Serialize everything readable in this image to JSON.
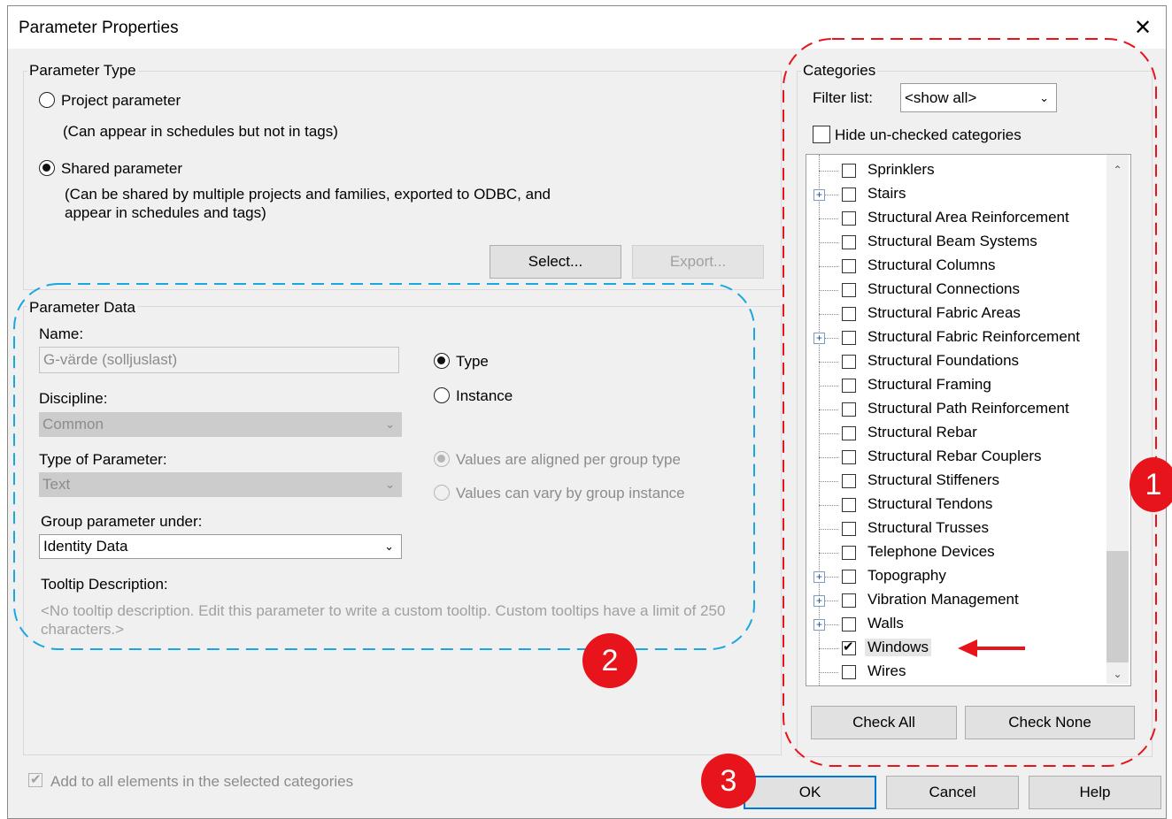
{
  "window": {
    "title": "Parameter Properties",
    "close_label": "✕"
  },
  "parameter_type": {
    "group_label": "Parameter Type",
    "project_label": "Project parameter",
    "project_desc": "(Can appear in schedules but not in tags)",
    "shared_label": "Shared parameter",
    "shared_desc_1": "(Can be shared by multiple projects and families, exported to ODBC, and",
    "shared_desc_2": "appear in schedules and tags)",
    "selected": "shared",
    "select_button": "Select...",
    "export_button": "Export..."
  },
  "parameter_data": {
    "group_label": "Parameter Data",
    "name_label": "Name:",
    "name_value": "G-värde (solljuslast)",
    "discipline_label": "Discipline:",
    "discipline_value": "Common",
    "type_label": "Type of Parameter:",
    "type_value": "Text",
    "group_under_label": "Group parameter under:",
    "group_under_value": "Identity Data",
    "tooltip_label": "Tooltip Description:",
    "tooltip_text_1": "<No tooltip description. Edit this parameter to write a custom tooltip. Custom tooltips have a limit of 250",
    "tooltip_text_2": "characters.>",
    "type_radio": "Type",
    "instance_radio": "Instance",
    "instance_kind": "type",
    "aligned_radio": "Values are aligned per group type",
    "vary_radio": "Values can vary by group instance"
  },
  "add_to_all": {
    "label": "Add to all elements in the selected categories",
    "checked": true,
    "disabled": true
  },
  "categories": {
    "group_label": "Categories",
    "filter_label": "Filter list:",
    "filter_value": "<show all>",
    "hide_unchecked_label": "Hide un-checked categories",
    "items": [
      {
        "label": "Sprinklers",
        "checked": false,
        "expandable": false
      },
      {
        "label": "Stairs",
        "checked": false,
        "expandable": true
      },
      {
        "label": "Structural Area Reinforcement",
        "checked": false,
        "expandable": false
      },
      {
        "label": "Structural Beam Systems",
        "checked": false,
        "expandable": false
      },
      {
        "label": "Structural Columns",
        "checked": false,
        "expandable": false
      },
      {
        "label": "Structural Connections",
        "checked": false,
        "expandable": false
      },
      {
        "label": "Structural Fabric Areas",
        "checked": false,
        "expandable": false
      },
      {
        "label": "Structural Fabric Reinforcement",
        "checked": false,
        "expandable": true
      },
      {
        "label": "Structural Foundations",
        "checked": false,
        "expandable": false
      },
      {
        "label": "Structural Framing",
        "checked": false,
        "expandable": false
      },
      {
        "label": "Structural Path Reinforcement",
        "checked": false,
        "expandable": false
      },
      {
        "label": "Structural Rebar",
        "checked": false,
        "expandable": false
      },
      {
        "label": "Structural Rebar Couplers",
        "checked": false,
        "expandable": false
      },
      {
        "label": "Structural Stiffeners",
        "checked": false,
        "expandable": false
      },
      {
        "label": "Structural Tendons",
        "checked": false,
        "expandable": false
      },
      {
        "label": "Structural Trusses",
        "checked": false,
        "expandable": false
      },
      {
        "label": "Telephone Devices",
        "checked": false,
        "expandable": false
      },
      {
        "label": "Topography",
        "checked": false,
        "expandable": true
      },
      {
        "label": "Vibration Management",
        "checked": false,
        "expandable": true
      },
      {
        "label": "Walls",
        "checked": false,
        "expandable": true
      },
      {
        "label": "Windows",
        "checked": true,
        "expandable": false,
        "selected": true
      },
      {
        "label": "Wires",
        "checked": false,
        "expandable": false
      }
    ],
    "check_all_button": "Check All",
    "check_none_button": "Check None"
  },
  "footer": {
    "ok_button": "OK",
    "cancel_button": "Cancel",
    "help_button": "Help"
  },
  "annotations": {
    "badge_1": "1",
    "badge_2": "2",
    "badge_3": "3",
    "red_color": "#e8141b",
    "blue_color": "#1aa7e0"
  }
}
